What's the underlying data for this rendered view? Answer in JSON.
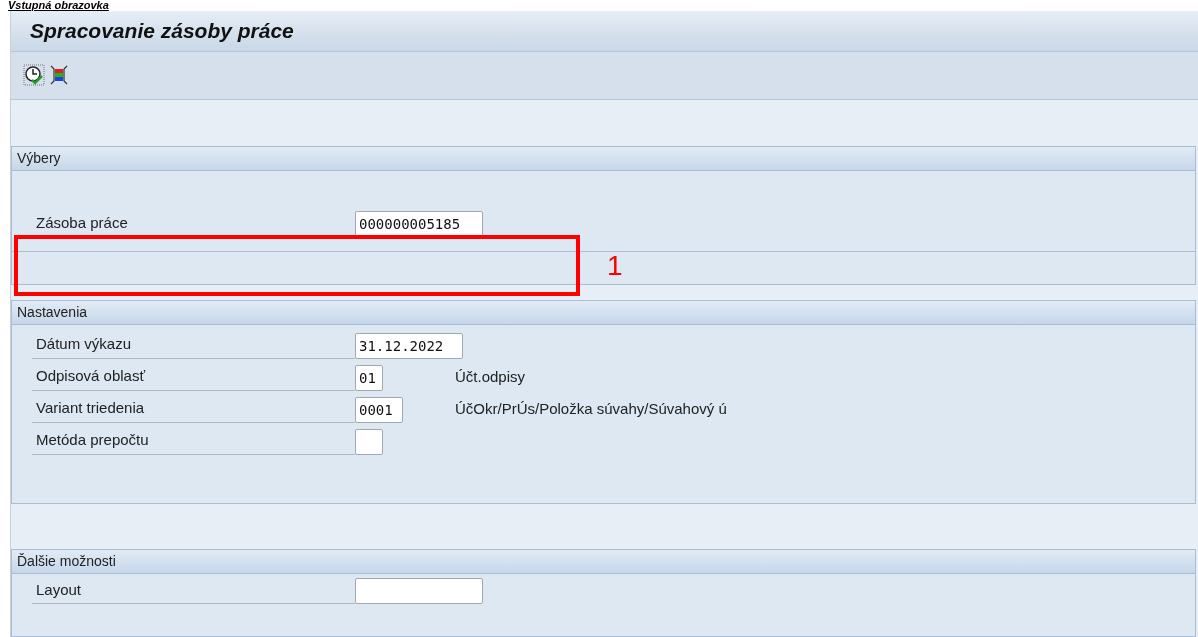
{
  "heading": "Vstupná obrazovka",
  "window": {
    "title": "Spracovanie zásoby práce"
  },
  "toolbar": [
    {
      "kind": "clock"
    },
    {
      "kind": "layout"
    }
  ],
  "groups": [
    {
      "title": "Výbery",
      "rows": [
        {
          "label": "Zásoba práce",
          "value": "000000005185"
        }
      ]
    },
    {
      "title": "Nastavenia",
      "rows": [
        {
          "label": "Dátum výkazu",
          "value": "31.12.2022"
        },
        {
          "label": "Odpisová oblasť",
          "value": "01",
          "description": "Účt.odpisy"
        },
        {
          "label": "Variant triedenia",
          "value": "0001",
          "description": "ÚčOkr/PrÚs/Položka súvahy/Súvahový ú"
        },
        {
          "label": "Metóda prepočtu"
        }
      ]
    },
    {
      "title": "Ďalšie možnosti",
      "rows": [
        {
          "label": "Layout"
        }
      ]
    }
  ],
  "annotation": {
    "label": "1"
  }
}
